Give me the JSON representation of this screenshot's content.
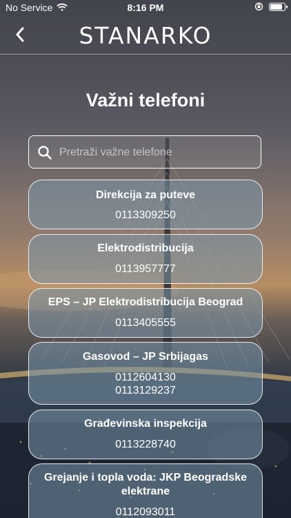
{
  "status_bar": {
    "carrier": "No Service",
    "time": "8:16 PM"
  },
  "nav": {
    "logo": "STANARKO"
  },
  "page": {
    "title": "Važni telefoni"
  },
  "search": {
    "placeholder": "Pretraži važne telefone",
    "value": ""
  },
  "contacts": [
    {
      "name": "Direkcija za puteve",
      "phones": [
        "0113309250"
      ]
    },
    {
      "name": "Elektrodistribucija",
      "phones": [
        "0113957777"
      ]
    },
    {
      "name": "EPS – JP Elektrodistribucija Beograd",
      "phones": [
        "0113405555"
      ]
    },
    {
      "name": "Gasovod – JP Srbijagas",
      "phones": [
        "0112604130",
        "0113129237"
      ]
    },
    {
      "name": "Građevinska inspekcija",
      "phones": [
        "0113228740"
      ]
    },
    {
      "name": "Grejanje i topla voda: JKP Beogradske elektrane",
      "phones": [
        "0112093011"
      ]
    }
  ]
}
